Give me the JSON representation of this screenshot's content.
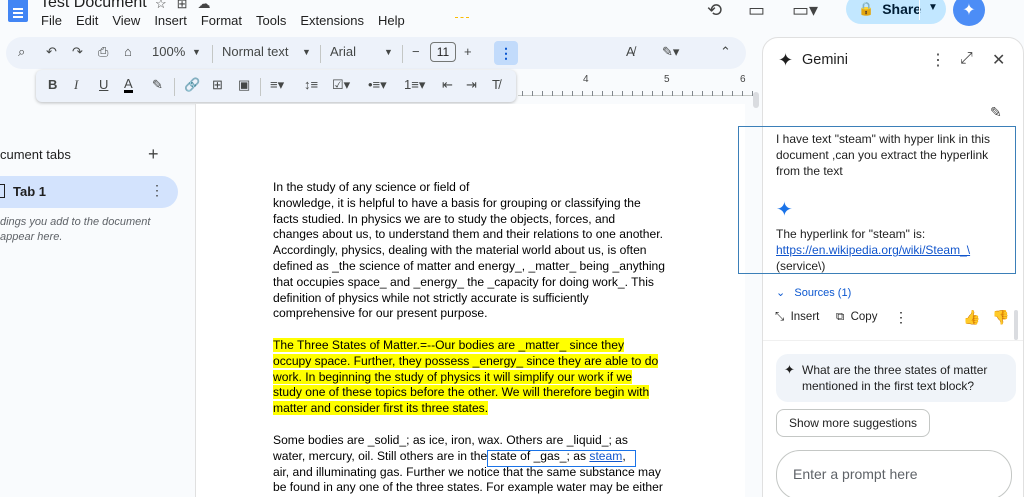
{
  "app": {
    "doc_title": "Test Document",
    "menu": [
      "File",
      "Edit",
      "View",
      "Insert",
      "Format",
      "Tools",
      "Extensions",
      "Help"
    ],
    "share_label": "Share"
  },
  "toolbar": {
    "zoom": "100%",
    "style": "Normal text",
    "font": "Arial",
    "font_size": "11"
  },
  "ruler": {
    "labels": [
      "4",
      "5",
      "6"
    ]
  },
  "left_pane": {
    "title": "cument tabs",
    "tab_label": "Tab 1",
    "hint_line1": "dings you add to the document",
    "hint_line2": "appear here."
  },
  "document": {
    "p1_lines": [
      "In the study of any science or field of",
      "knowledge, it is helpful to have a basis for grouping or classifying the",
      "facts studied. In physics we are to study the objects, forces, and",
      "changes about us, to understand them and their relations to one another.",
      "Accordingly, physics, dealing with the material world about us, is often",
      "defined as _the science of matter and energy_, _matter_ being _anything",
      "that occupies space_ and _energy_ the _capacity for doing work_. This",
      "definition of physics while not strictly accurate is sufficiently",
      "comprehensive for our present purpose."
    ],
    "p2_lines": [
      "The Three States of Matter.=--Our bodies are _matter_ since they",
      "occupy space. Further, they possess _energy_ since they are able to do",
      "work. In beginning the study of physics it will simplify our work if we",
      "study one of these topics before the other. We will therefore begin with",
      "matter and consider first its three states."
    ],
    "p3_line1": "Some bodies are _solid_; as ice, iron, wax. Others are _liquid_; as",
    "p3_line2_prefix": "water, mercury, oil. Still others are in the ",
    "p3_line2_mid": "state of _gas_; as ",
    "p3_link": "steam",
    "p3_line2_suffix": ",",
    "p3_line3": "air, and illuminating gas. Further we notice that the same substance may",
    "p3_line4": "be found in any one of the three states. For example water may be either"
  },
  "gemini": {
    "title": "Gemini",
    "question": "I have text \"steam\" with hyper link in this document ,can you extract the hyperlink from the text",
    "answer_intro": "The hyperlink for \"steam\" is:",
    "answer_link": "https://en.wikipedia.org/wiki/Steam_\\",
    "answer_tail": "(service\\)",
    "sources": "Sources (1)",
    "insert_label": "Insert",
    "copy_label": "Copy",
    "suggestion": "What are the three states of matter mentioned in the first text block?",
    "show_more": "Show more suggestions",
    "prompt_placeholder": "Enter a prompt here"
  }
}
